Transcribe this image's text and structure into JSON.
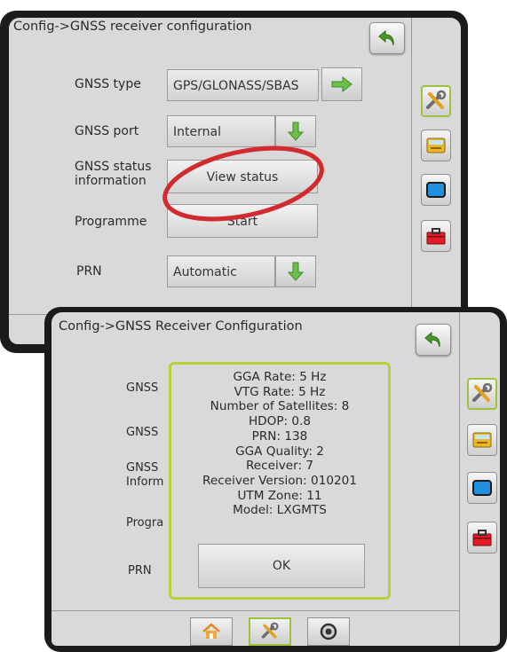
{
  "top": {
    "title": "Config->GNSS receiver configuration",
    "rows": [
      {
        "label": "GNSS type",
        "value": "GPS/GLONASS/SBAS"
      },
      {
        "label": "GNSS port",
        "value": "Internal"
      },
      {
        "label": "GNSS status information",
        "button": "View status"
      },
      {
        "label": "Programme",
        "button": "Start"
      },
      {
        "label": "PRN",
        "value": "Automatic"
      }
    ],
    "highlight_color": "#d12a2f"
  },
  "bottom": {
    "title": "Config->GNSS Receiver Configuration",
    "partial_labels": [
      "GNSS",
      "GNSS",
      "GNSS",
      "Inform",
      "Progra",
      "PRN"
    ],
    "status_lines": [
      "GGA Rate: 5 Hz",
      "VTG Rate: 5 Hz",
      "Number of Satellites: 8",
      "HDOP: 0.8",
      "PRN: 138",
      "GGA Quality: 2",
      "Receiver: 7",
      "Receiver Version: 010201",
      "UTM Zone: 11",
      "Model: LXGMTS"
    ],
    "ok_label": "OK",
    "popup_border_color": "#b6d33b",
    "bottom_tabs": [
      "home-icon",
      "tools-icon",
      "gauge-icon"
    ]
  },
  "side_icons": [
    "tools-icon",
    "console-icon",
    "display-icon",
    "toolbox-icon"
  ],
  "accent_green": "#9bc33b",
  "arrow_green": "#6cc04a",
  "back_arrow_green": "#4a9a2a"
}
